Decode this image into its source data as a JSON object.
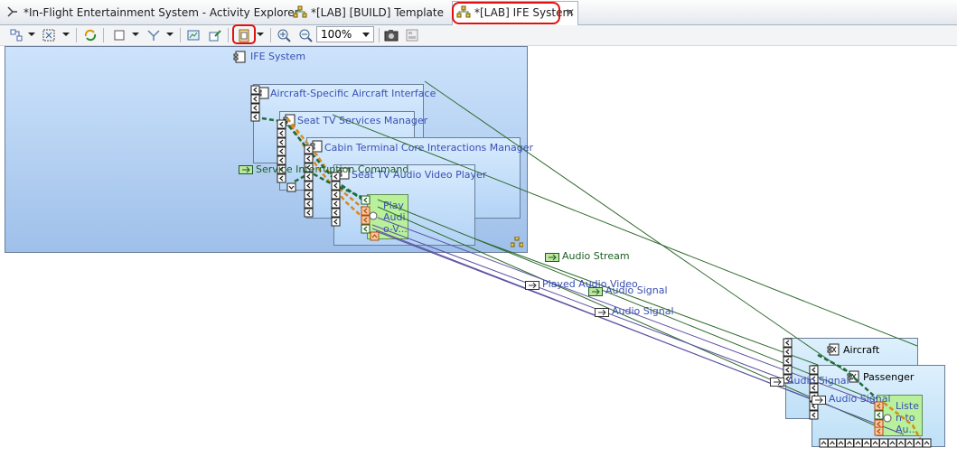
{
  "tabs": [
    {
      "label": "*In-Flight Entertainment System - Activity Explorer",
      "icon": "activity-explorer-icon",
      "active": false
    },
    {
      "label": "*[LAB] [BUILD] Template",
      "icon": "diagram-icon",
      "active": false
    },
    {
      "label": "*[LAB] IFE System",
      "icon": "diagram-icon",
      "active": true
    }
  ],
  "toolbar": {
    "zoom": "100%",
    "highlight_color": "#e01010"
  },
  "diagram": {
    "system": "IFE System",
    "components": {
      "aircraft_interface": "Aircraft-Specific Aircraft Interface",
      "seat_tv_services": "Seat TV Services Manager",
      "cabin_terminal": "Cabin Terminal Core Interactions Manager",
      "seat_tv_player": "Seat TV Audio Video Player",
      "play_function": "Play Audio-V...",
      "aircraft": "Aircraft",
      "passenger": "Passenger",
      "listen_function": "Listen to Au..."
    },
    "exchanges": {
      "service_interruption": "Service Interruption Command",
      "audio_stream": "Audio Stream",
      "played_audio_video": "Played Audio Video",
      "audio_signal_1": "Audio Signal",
      "audio_signal_2": "Audio Signal",
      "audio_signal_3": "Audio Signal",
      "audio_signal_4": "Audio Signal"
    },
    "colors": {
      "exchange_green": "#2e6b2e",
      "exchange_purple": "#5a4fa0",
      "dashed_orange": "#d8891b",
      "dashed_green": "#1f6b3a"
    }
  }
}
